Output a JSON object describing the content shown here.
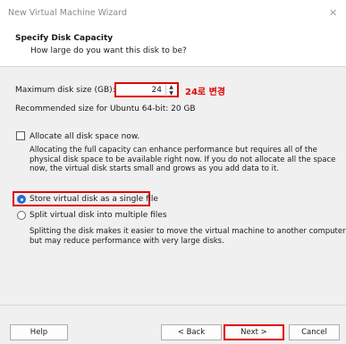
{
  "window": {
    "title": "New Virtual Machine Wizard",
    "close_glyph": "✕"
  },
  "header": {
    "title": "Specify Disk Capacity",
    "subtitle": "How large do you want this disk to be?"
  },
  "disk": {
    "label": "Maximum disk size (GB):",
    "value": "24",
    "annotation": "24로 변경",
    "recommended": "Recommended size for Ubuntu 64-bit: 20 GB"
  },
  "allocate": {
    "label": "Allocate all disk space now.",
    "checked": false,
    "desc_lines": [
      "Allocating the full capacity can enhance performance but requires all of the",
      "physical disk space to be available right now. If you do not allocate all the space",
      "now, the virtual disk starts small and grows as you add data to it."
    ]
  },
  "storage": {
    "single_label": "Store virtual disk as a single file",
    "split_label": "Split virtual disk into multiple files",
    "selected": "single",
    "desc_lines": [
      "Splitting the disk makes it easier to move the virtual machine to another computer",
      "but may reduce performance with very large disks."
    ]
  },
  "buttons": {
    "help": "Help",
    "back": "< Back",
    "next": "Next >",
    "cancel": "Cancel"
  },
  "colors": {
    "highlight": "#e00000",
    "accent": "#1f6fd1"
  }
}
